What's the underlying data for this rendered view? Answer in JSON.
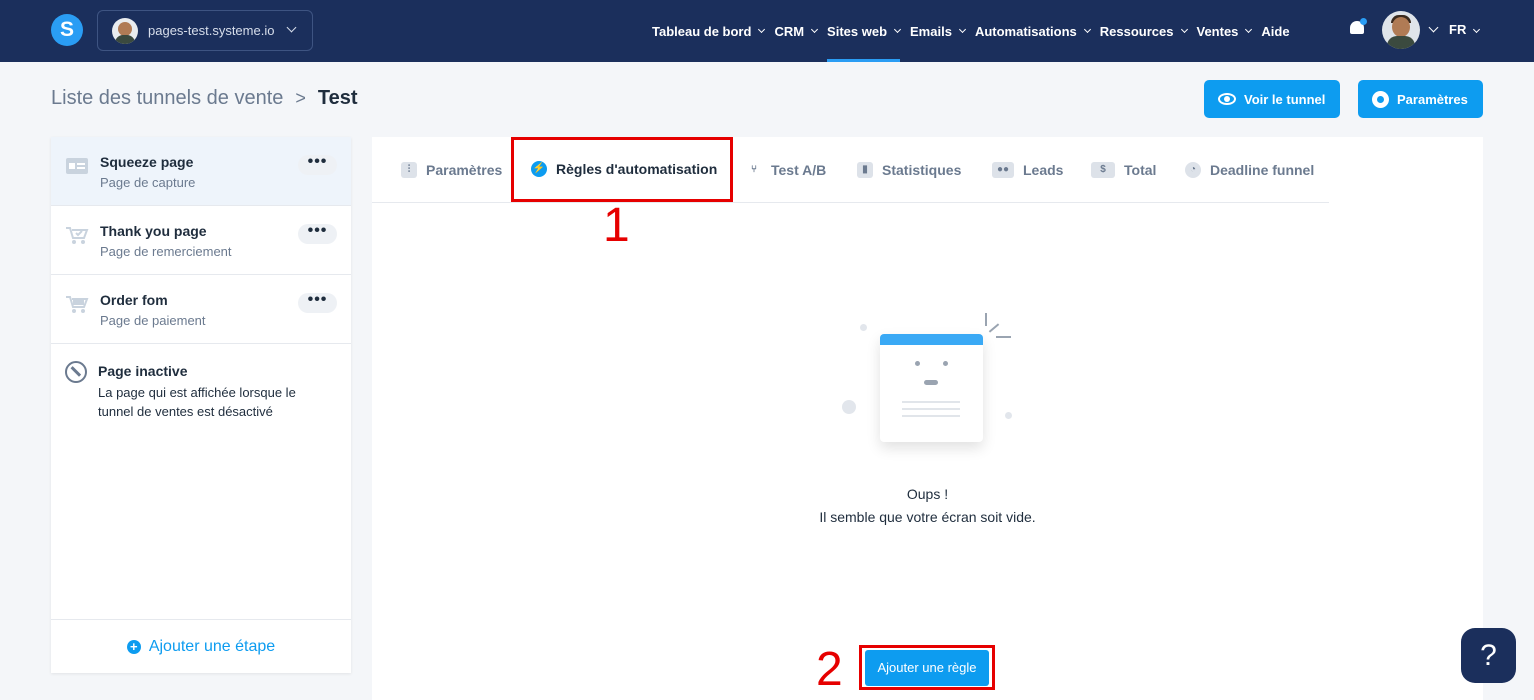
{
  "topbar": {
    "logo_letter": "S",
    "site": "pages-test.systeme.io",
    "nav": [
      "Tableau de bord",
      "CRM",
      "Sites web",
      "Emails",
      "Automatisations",
      "Ressources",
      "Ventes",
      "Aide"
    ],
    "active_nav": "Sites web",
    "lang": "FR"
  },
  "breadcrumb": {
    "root": "Liste des tunnels de vente",
    "separator": ">",
    "current": "Test"
  },
  "actions": {
    "view_funnel": "Voir le tunnel",
    "settings": "Paramètres"
  },
  "sidebar": {
    "steps": [
      {
        "title": "Squeeze page",
        "subtitle": "Page de capture",
        "icon": "squeeze-page-icon",
        "menu": "•••"
      },
      {
        "title": "Thank you page",
        "subtitle": "Page de remerciement",
        "icon": "cart-check-icon",
        "menu": "•••"
      },
      {
        "title": "Order fom",
        "subtitle": "Page de paiement",
        "icon": "cart-icon",
        "menu": "•••"
      }
    ],
    "inactive": {
      "title": "Page inactive",
      "description": "La page qui est affichée lorsque le tunnel de ventes est désactivé"
    },
    "add_step": "Ajouter une étape"
  },
  "tabs": [
    {
      "label": "Paramètres",
      "icon": "sliders-icon"
    },
    {
      "label": "Règles d'automatisation",
      "icon": "lightning-icon"
    },
    {
      "label": "Test A/B",
      "icon": "split-icon"
    },
    {
      "label": "Statistiques",
      "icon": "stats-icon"
    },
    {
      "label": "Leads",
      "icon": "users-icon"
    },
    {
      "label": "Total",
      "icon": "dollar-icon"
    },
    {
      "label": "Deadline funnel",
      "icon": "clock-icon"
    }
  ],
  "active_tab": "Règles d'automatisation",
  "annotations": {
    "one": "1",
    "two": "2"
  },
  "empty_state": {
    "title": "Oups !",
    "subtitle": "Il semble que votre écran soit vide."
  },
  "add_rule": "Ajouter une règle",
  "help": "?",
  "colors": {
    "navy": "#1b2f5c",
    "accent": "#0d9cf0",
    "annotation": "#e60000"
  }
}
